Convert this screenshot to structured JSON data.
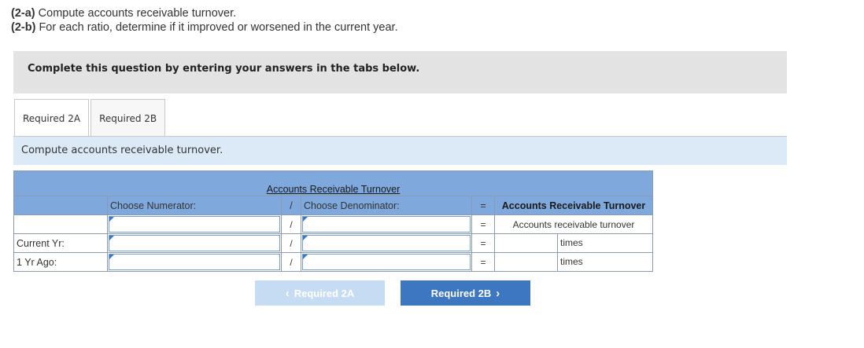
{
  "instructions": {
    "line1_tag": "(2-a)",
    "line1_text": " Compute accounts receivable turnover.",
    "line2_tag": "(2-b)",
    "line2_text": " For each ratio, determine if it improved or worsened in the current year."
  },
  "banner": {
    "text": "Complete this question by entering your answers in the tabs below."
  },
  "tabs": [
    {
      "label": "Required 2A",
      "active": true
    },
    {
      "label": "Required 2B",
      "active": false
    }
  ],
  "prompt": {
    "text": "Compute accounts receivable turnover."
  },
  "table": {
    "title": "Accounts Receivable Turnover",
    "header": {
      "numerator": "Choose Numerator:",
      "divide": "/",
      "denominator": "Choose Denominator:",
      "equals": "=",
      "result": "Accounts Receivable Turnover"
    },
    "subheader": {
      "divide": "/",
      "equals": "=",
      "result": "Accounts receivable turnover"
    },
    "rows": [
      {
        "label": "Current Yr:",
        "divide": "/",
        "equals": "=",
        "unit": "times"
      },
      {
        "label": "1 Yr Ago:",
        "divide": "/",
        "equals": "=",
        "unit": "times"
      }
    ]
  },
  "nav": {
    "prev_label": "Required 2A",
    "prev_chevron": "‹",
    "next_label": "Required 2B",
    "next_chevron": "›"
  },
  "colors": {
    "header_blue": "#7fa9dc",
    "prompt_bg": "#dbeaf6",
    "next_button": "#3e77c1",
    "prev_button_disabled": "#c6dcf2"
  }
}
